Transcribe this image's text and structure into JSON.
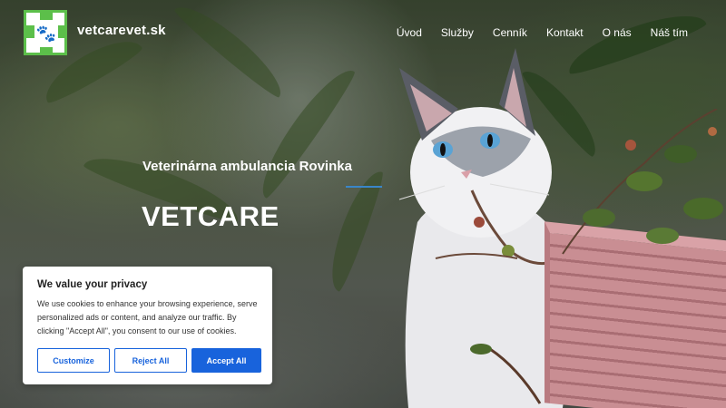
{
  "header": {
    "brand": "vetcarevet.sk",
    "logo_icon": "vet-cross-logo",
    "nav": [
      {
        "label": "Úvod"
      },
      {
        "label": "Služby"
      },
      {
        "label": "Cenník"
      },
      {
        "label": "Kontakt"
      },
      {
        "label": "O nás"
      },
      {
        "label": "Náš tím"
      }
    ]
  },
  "hero": {
    "subtitle": "Veterinárna ambulancia Rovinka",
    "title": "VETCARE",
    "image": "cat-with-plants-photo"
  },
  "cookie_banner": {
    "title": "We value your privacy",
    "text": "We use cookies to enhance your browsing experience, serve personalized ads or content, and analyze our traffic. By clicking \"Accept All\", you consent to our use of cookies.",
    "customize_label": "Customize",
    "reject_label": "Reject All",
    "accept_label": "Accept All"
  },
  "colors": {
    "accent": "#1863dc",
    "logo_green": "#5cbf4a",
    "divider": "#3a86c8"
  }
}
